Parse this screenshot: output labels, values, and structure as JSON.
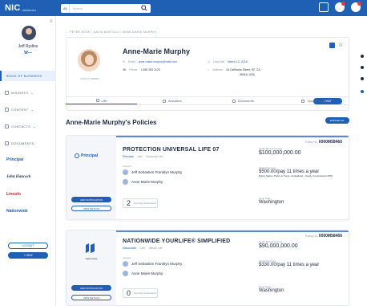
{
  "topbar": {
    "brand": "NIC",
    "brand_sub": "distributor",
    "search_select": "All",
    "search_placeholder": "Search"
  },
  "sidebar": {
    "user_name": "Jeff Rydins",
    "items": [
      {
        "label": "BOOK OF BUSINESS",
        "active": true
      },
      {
        "label": "INSIGHTS"
      },
      {
        "label": "CONTENT"
      },
      {
        "label": "CONTACTS"
      },
      {
        "label": "DOCUMENTS"
      }
    ],
    "carriers": [
      "Principal",
      "John Hancock",
      "Lincoln",
      "Nationwide"
    ],
    "btn_outline": "LOGOUT",
    "btn_solid": "+ NEW"
  },
  "breadcrumb": "← PETER BOOK  /  DAVID BERTOLLI  /  ANNE-MARIE MURPHY",
  "profile": {
    "name": "Anne-Marie Murphy",
    "photo_label": "POLICY OWNER",
    "email_label": "Email",
    "email": "anne-marie.murphy@mail.com",
    "phone_label": "Phone",
    "phone": "1 650 283 2123",
    "last_visit_label": "Last Visit",
    "last_visit": "March 12, 2018",
    "address_label": "Address",
    "address_1": "15 California Street, SF, CA",
    "address_2": "95016, USA",
    "chat_btn": "CHAT"
  },
  "tabs": [
    {
      "label": "Life",
      "active": true
    },
    {
      "label": "Annuities"
    },
    {
      "label": "Documents"
    },
    {
      "label": "Opportunities"
    }
  ],
  "section_title": "Anne-Marie Murphy's Policies",
  "expand_btn": "EXPAND ALL",
  "policies": [
    {
      "logo": "Principal",
      "title": "PROTECTION UNIVERSAL LIFE 07",
      "carrier": "Principal",
      "type1": "Life",
      "type2": "Universal Life",
      "insured_label": "Insured",
      "person1": "Jeff Sebastien Franklyn Murphy",
      "person2": "Anne Marie Murphy",
      "pending_count": "2",
      "pending_label": "Pending Notifications",
      "btn_add": "ADD NOTIFICATION",
      "btn_view": "VIEW DETAILS",
      "policy_no_label": "Policy No.",
      "policy_no": "0000M58466",
      "death_label": "Death Benefit Amount",
      "death": "$100,000,000.00",
      "premium_label": "Model Premium",
      "premium": "$500.00/pay 11 times a year",
      "premium_note": "Policy Status: Policy in Force. Annualized - Yearly, Commissions 50%",
      "state_label": "Issue State",
      "state": "Washington"
    },
    {
      "logo": "Nationwide",
      "title": "NATIONWIDE YOURLIFE® SIMPLIFIED",
      "carrier": "Nationwide",
      "type1": "Life",
      "type2": "Whole Life",
      "insured_label": "Insured",
      "person1": "Jeff Sebastien Franklyn Murphy",
      "person2": "Anne Marie Murphy",
      "pending_count": "0",
      "pending_label": "Pending Notifications",
      "btn_add": "ADD NOTIFICATION",
      "btn_view": "VIEW DETAILS",
      "policy_no_label": "Policy No.",
      "policy_no": "0000M58466",
      "death_label": "Death Benefit Amount",
      "death": "$90,000,000.00",
      "premium_label": "Model Premium",
      "premium": "$330.00/pay 11 times a year",
      "state_label": "Issue State",
      "state": "Washington"
    }
  ]
}
